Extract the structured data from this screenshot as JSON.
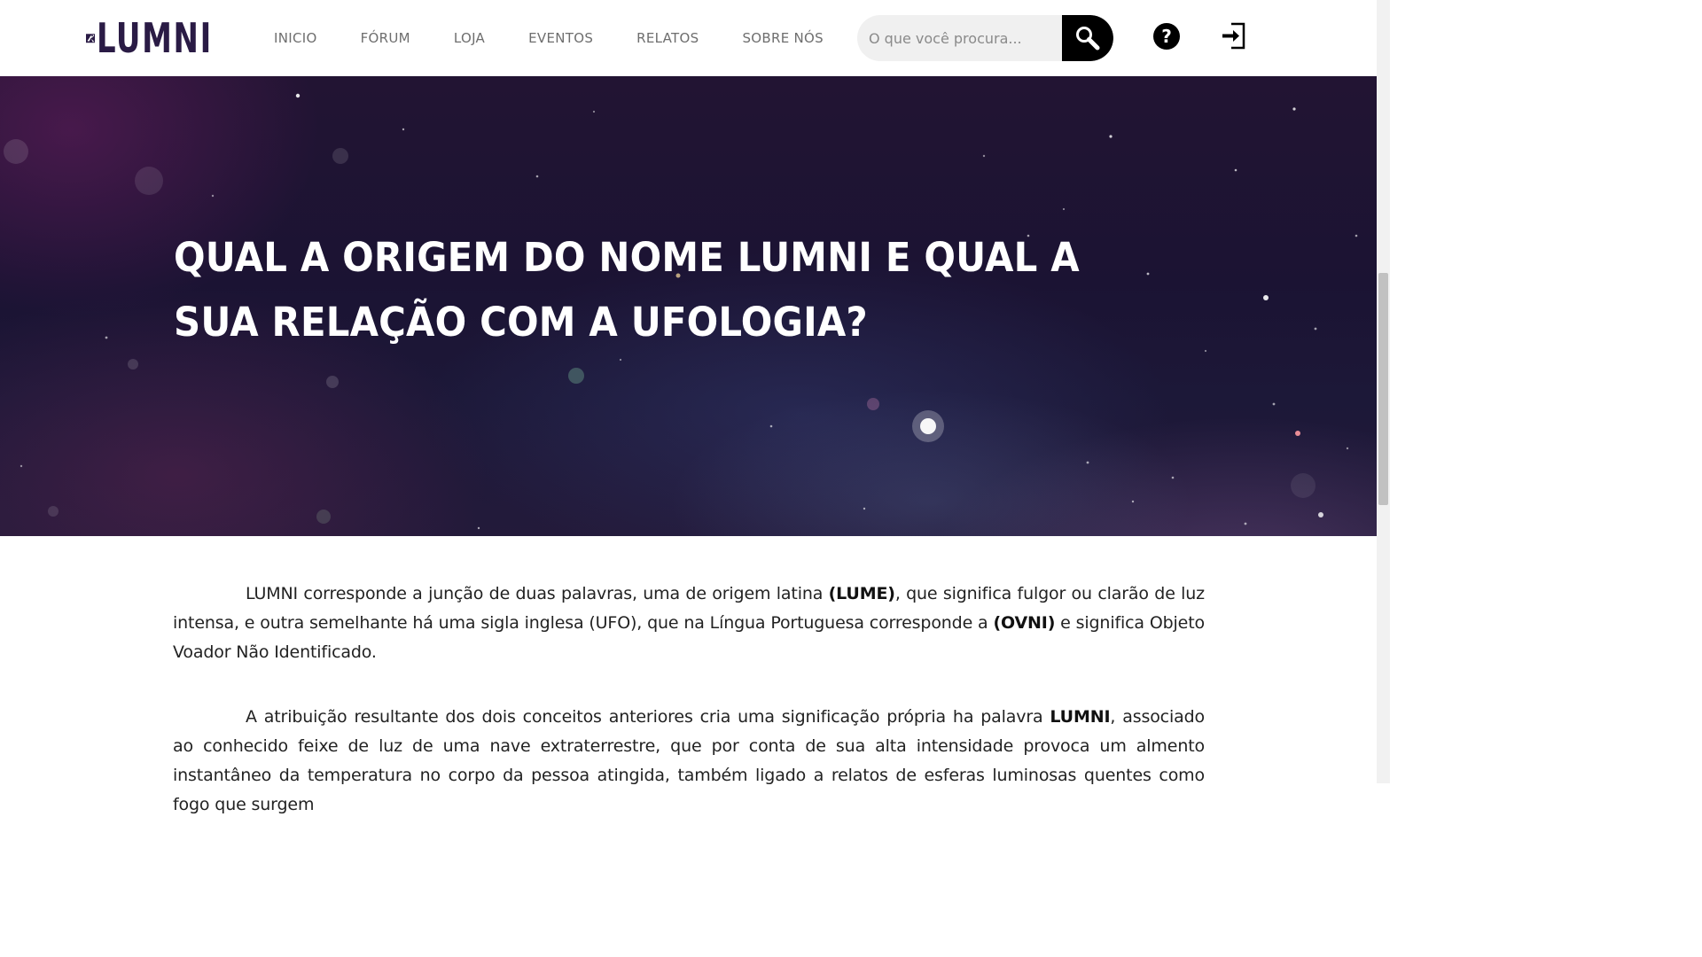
{
  "header": {
    "logo_text": "LUMNI",
    "nav": [
      "INICIO",
      "FÓRUM",
      "LOJA",
      "EVENTOS",
      "RELATOS",
      "SOBRE NÓS"
    ],
    "search_placeholder": "O que você procura...",
    "help_symbol": "?"
  },
  "icons": {
    "search": "search-icon",
    "help": "question-circle-icon",
    "login": "login-icon",
    "logo": "ufo-logo-icon"
  },
  "hero": {
    "title": "QUAL A ORIGEM DO NOME LUMNI E QUAL A SUA RELAÇÃO COM A UFOLOGIA?"
  },
  "article": {
    "p1": {
      "t1": "LUMNI corresponde a junção de duas palavras, uma de origem latina ",
      "b1": "(LUME)",
      "t2": ", que significa fulgor ou clarão de luz intensa, e outra semelhante há uma sigla inglesa (UFO), que na Língua Portuguesa corresponde a ",
      "b2": "(OVNI)",
      "t3": " e significa Objeto Voador Não Identificado."
    },
    "p2": {
      "t1": "A atribuição resultante dos dois conceitos anteriores cria uma significação própria ha palavra ",
      "b1": "LUMNI",
      "t2": ", associado ao conhecido feixe de luz de uma nave extraterrestre, que por conta de sua alta intensidade provoca um almento instantâneo da temperatura no corpo da pessoa atingida, também ligado a relatos de esferas luminosas quentes como fogo que surgem"
    }
  },
  "colors": {
    "logo": "#2a1b45",
    "nav_text": "#6e6e6e",
    "search_bg": "#f0f0f0",
    "hero_bg": "#1b1333",
    "text": "#222222"
  }
}
